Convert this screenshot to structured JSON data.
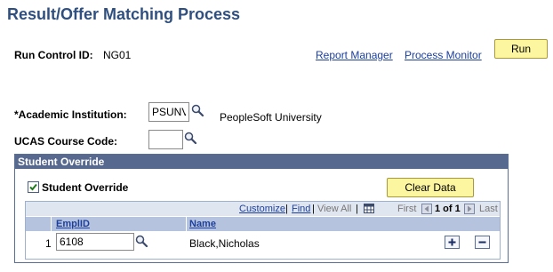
{
  "page": {
    "title": "Result/Offer Matching Process"
  },
  "run_control": {
    "label": "Run Control ID:",
    "value": "NG01",
    "report_manager": "Report Manager",
    "process_monitor": "Process Monitor",
    "run_label": "Run"
  },
  "form": {
    "institution_label": "*Academic Institution:",
    "institution_value": "PSUNV",
    "institution_desc": "PeopleSoft University",
    "ucas_label": "UCAS Course Code:",
    "ucas_value": ""
  },
  "student_override": {
    "header": "Student Override",
    "checkbox_label": "Student Override",
    "checked": true,
    "clear_label": "Clear Data",
    "grid": {
      "customize": "Customize",
      "find": "Find",
      "view_all": "View All",
      "first": "First",
      "page_info": "1 of 1",
      "last": "Last",
      "columns": [
        "EmplID",
        "Name"
      ],
      "rows": [
        {
          "num": "1",
          "emplid": "6108",
          "name": "Black,Nicholas"
        }
      ]
    }
  },
  "icons": {
    "lookup": "magnifier-icon",
    "grid": "grid-icon",
    "prev": "arrow-left-icon",
    "next": "arrow-right-icon",
    "add": "plus-icon",
    "delete": "minus-icon"
  }
}
